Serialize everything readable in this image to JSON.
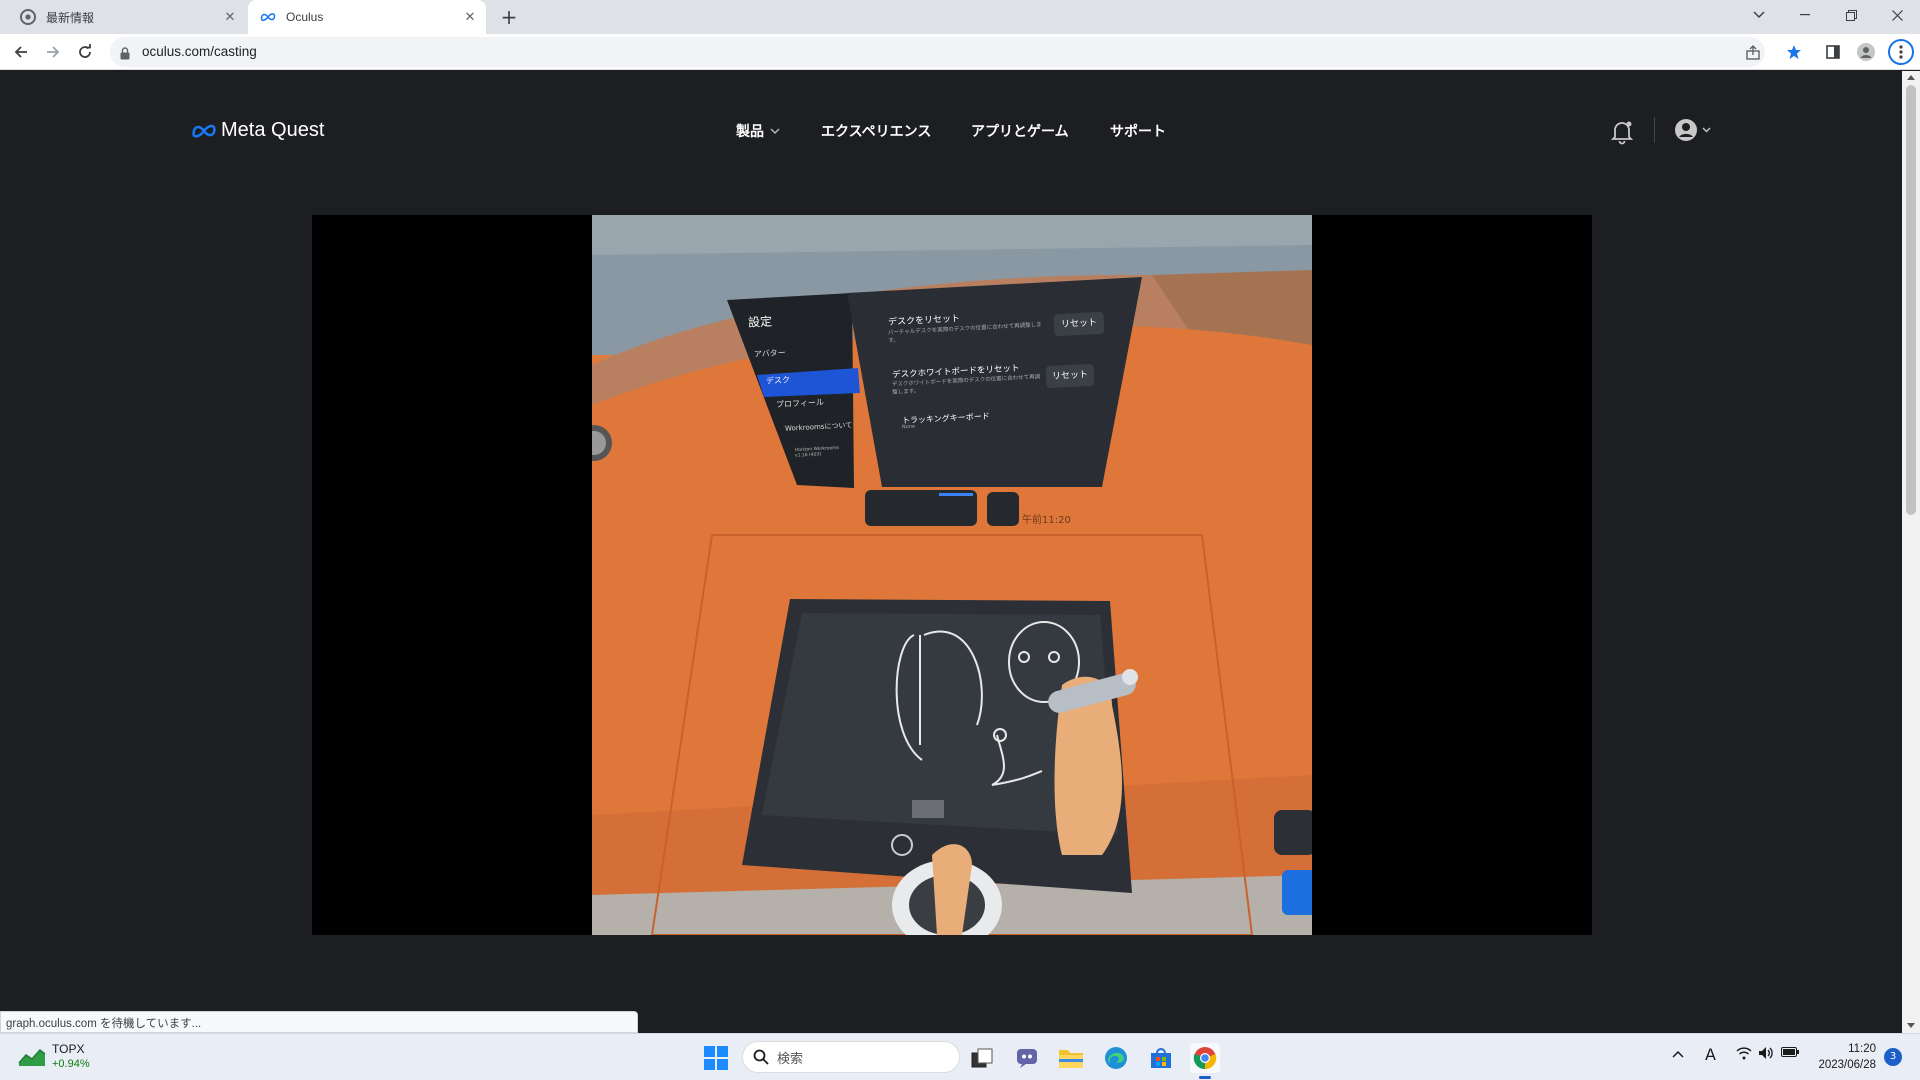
{
  "browser": {
    "tabs": [
      {
        "title": "最新情報",
        "icon": "chrome-favicon"
      },
      {
        "title": "Oculus",
        "icon": "meta-favicon"
      }
    ],
    "url": "oculus.com/casting",
    "status_text": "graph.oculus.com を待機しています..."
  },
  "site": {
    "logo_text": "Meta Quest",
    "nav": [
      {
        "label": "製品"
      },
      {
        "label": "エクスペリエンス"
      },
      {
        "label": "アプリとゲーム"
      },
      {
        "label": "サポート"
      }
    ]
  },
  "vr_panel": {
    "title": "設定",
    "menu": [
      "アバター",
      "デスク",
      "プロフィール",
      "Workroomsについて"
    ],
    "selected_menu": "デスク",
    "version_title": "Horizon Workrooms",
    "version_number": "v1.16 (403)",
    "settings": [
      {
        "title": "デスクをリセット",
        "desc": "バーチャルデスクを実際のデスクの位置に合わせて再調整します。",
        "button": "リセット"
      },
      {
        "title": "デスクホワイトボードをリセット",
        "desc": "デスクホワイトボードを実際のデスクの位置に合わせて再調整します。",
        "button": "リセット"
      },
      {
        "title": "トラッキングキーボード",
        "desc": "None"
      }
    ],
    "dock_time": "午前11:20"
  },
  "taskbar": {
    "stock_name": "TOPX",
    "stock_change": "+0.94%",
    "search_label": "検索",
    "time": "11:20",
    "date": "2023/06/28",
    "notification_count": "3",
    "ime_label": "A"
  }
}
